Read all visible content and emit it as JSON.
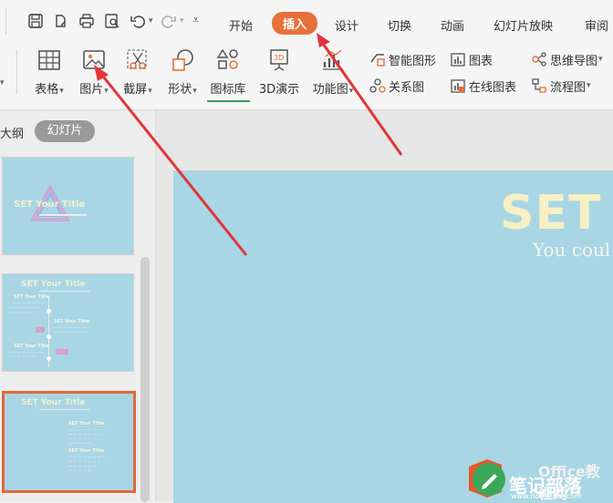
{
  "tabs": [
    "开始",
    "插入",
    "设计",
    "切换",
    "动画",
    "幻灯片放映",
    "审阅"
  ],
  "active_tab": "插入",
  "ribbon": {
    "table": "表格",
    "picture": "图片",
    "screenshot": "截屏",
    "shape": "形状",
    "iconlib": "图标库",
    "demo3d": "3D演示",
    "funcchart": "功能图",
    "smartart": "智能图形",
    "chart": "图表",
    "mindmap": "思维导图",
    "relation": "关系图",
    "onlinechart": "在线图表",
    "flowchart": "流程图"
  },
  "panel": {
    "outline_tab": "大纲",
    "slides_tab": "幻灯片"
  },
  "thumbs": {
    "t1_title": "SET Your Title",
    "t2_title": "SET Your Title",
    "t2_sub1": "SET Your Title",
    "t2_sub2": "SET Your Title",
    "t2_sub3": "SET Your Title",
    "t3_title": "SET Your Title",
    "t3_sub1": "SET Your Title",
    "t3_sub2": "SET Your Title"
  },
  "slide": {
    "title": "SET Y",
    "subtitle": "You coul"
  },
  "watermark": {
    "brand": "Office教程网",
    "name": "笔记部落",
    "url": "www.notetribe.com"
  },
  "colors": {
    "accent": "#e8703a",
    "slide_bg": "#a9d6e5",
    "title_color": "#f6f0c4",
    "arrow_red": "#e0353a"
  }
}
